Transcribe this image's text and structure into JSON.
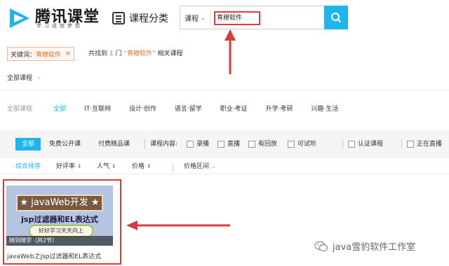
{
  "header": {
    "logo_title": "腾讯课堂",
    "logo_sub": "学习成就梦想",
    "category_nav_label": "课程分类",
    "search": {
      "scope": "课程",
      "query": "育穆软件"
    }
  },
  "filters": {
    "keyword_label": "关键词：",
    "keyword_value": "育穆软件",
    "close_glyph": "×",
    "found": {
      "prefix": "共找到 ",
      "count": "1",
      "middle": " 门 ",
      "term": "“育穆软件”",
      "suffix": " 相关课程"
    },
    "breadcrumb": "全部课程",
    "category_heading": "全部课程",
    "categories": [
      "全部",
      "IT·互联网",
      "设计·创作",
      "语言·留学",
      "职业·考证",
      "升学·考研",
      "兴趣·生活"
    ],
    "type_tabs": [
      "全部",
      "免费公开课",
      "付费精品课"
    ],
    "content_label": "课程内容:",
    "content_options": [
      "录播",
      "直播",
      "有回放",
      "可试听"
    ],
    "cert_label": "认证课程",
    "live_label": "正在直播",
    "sort": [
      "综合排序",
      "好评率",
      "人气",
      "价格"
    ],
    "sort_arrows": [
      "⬇",
      "⬇",
      "⬍"
    ],
    "price_range": "价格区间"
  },
  "course": {
    "banner": "★ javaWeb开发 ★",
    "subtitle": "jsp过滤器和EL表达式",
    "slogan": "好好学习天天向上",
    "tag": "随到随学（共2节）",
    "title": "javaWeb之jsp过滤器和EL表达式"
  },
  "watermark": "java雪豹软件工作室",
  "colors": {
    "accent": "#1eb5ec",
    "highlight": "#ee6a1f",
    "annotation": "#d93a3a"
  }
}
